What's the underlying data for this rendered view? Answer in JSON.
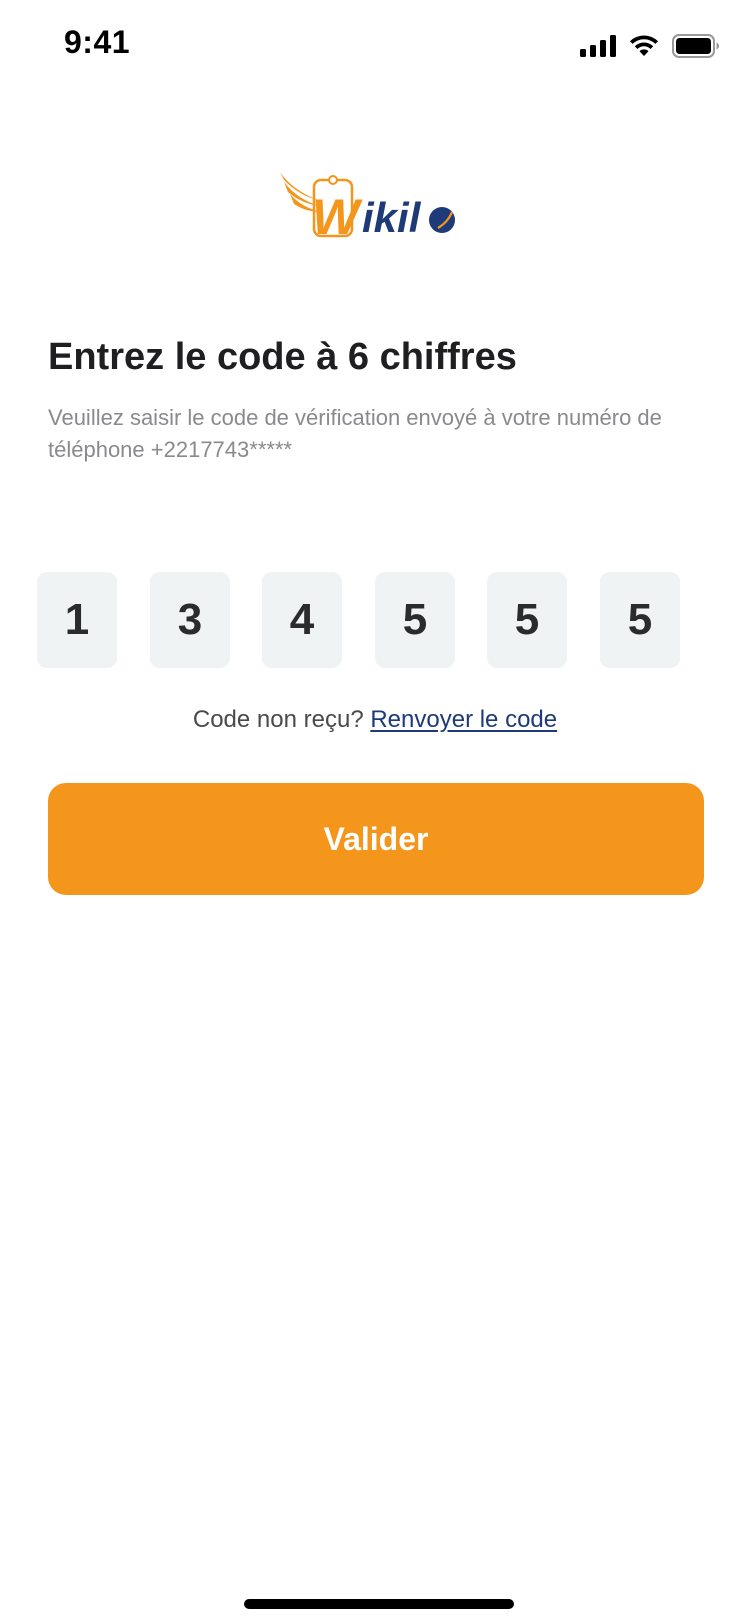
{
  "status_bar": {
    "time": "9:41",
    "icons": [
      "signal-icon",
      "wifi-icon",
      "battery-icon"
    ]
  },
  "brand": {
    "logo_text": "Wikilo",
    "colors": {
      "orange": "#f4951c",
      "navy": "#1e3a78"
    }
  },
  "verification": {
    "title": "Entrez le code à 6 chiffres",
    "subtitle": "Veuillez saisir le code de vérification envoyé à votre numéro de téléphone +2217743*****",
    "digits": [
      "1",
      "3",
      "4",
      "5",
      "5",
      "5"
    ],
    "resend_prompt": "Code non reçu?",
    "resend_link": "Renvoyer le code",
    "submit_label": "Valider"
  },
  "colors": {
    "button": "#f4951c",
    "link": "#1e3a78",
    "otp_box_bg": "#eff3f3",
    "subtitle_text": "#8a8a8e"
  }
}
